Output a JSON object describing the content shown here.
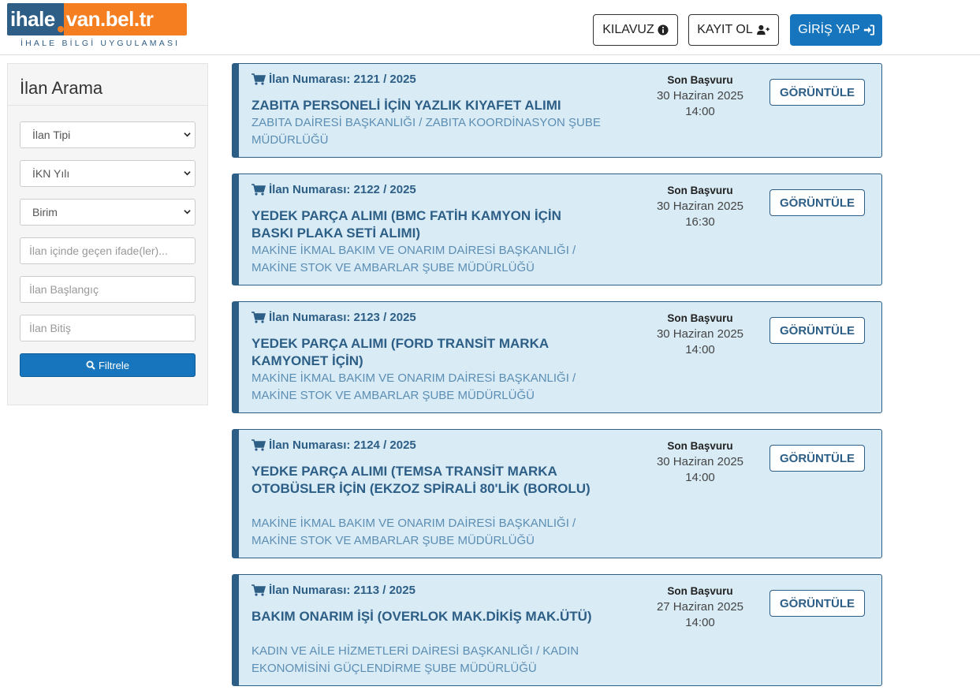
{
  "header": {
    "logo_left": "ihale",
    "logo_right": "van.bel.tr",
    "logo_sub": "İHALE BİLGİ UYGULAMASI",
    "guide_label": "KILAVUZ",
    "register_label": "KAYIT OL",
    "login_label": "GİRİŞ YAP",
    "icons": [
      "info-circle-icon",
      "user-plus-icon",
      "sign-in-icon"
    ]
  },
  "sidebar": {
    "title": "İlan Arama",
    "type_select": "İlan Tipi",
    "ikn_select": "İKN Yılı",
    "unit_select": "Birim",
    "text_placeholder": "İlan içinde geçen ifade(ler)...",
    "start_placeholder": "İlan Başlangıç",
    "end_placeholder": "İlan Bitiş",
    "filter_label": "Filtrele"
  },
  "listings": [
    {
      "number": "İlan Numarası: 2121 / 2025",
      "title": "ZABITA PERSONELİ İÇİN YAZLIK KIYAFET ALIMI",
      "unit": "ZABITA DAİRESİ BAŞKANLIĞI / ZABITA KOORDİNASYON ŞUBE MÜDÜRLÜĞÜ",
      "deadline_label": "Son Başvuru",
      "date": "30 Haziran 2025",
      "time": "14:00",
      "button": "GÖRÜNTÜLE"
    },
    {
      "number": "İlan Numarası: 2122 / 2025",
      "title": "YEDEK PARÇA ALIMI (BMC FATİH KAMYON İÇİN BASKI PLAKA SETİ ALIMI)",
      "unit": "MAKİNE İKMAL BAKIM VE ONARIM DAİRESİ BAŞKANLIĞI / MAKİNE STOK VE AMBARLAR ŞUBE MÜDÜRLÜĞÜ",
      "deadline_label": "Son Başvuru",
      "date": "30 Haziran 2025",
      "time": "16:30",
      "button": "GÖRÜNTÜLE"
    },
    {
      "number": "İlan Numarası: 2123 / 2025",
      "title": "YEDEK PARÇA ALIMI (FORD TRANSİT MARKA KAMYONET İÇİN)",
      "unit": "MAKİNE İKMAL BAKIM VE ONARIM DAİRESİ BAŞKANLIĞI / MAKİNE STOK VE AMBARLAR ŞUBE MÜDÜRLÜĞÜ",
      "deadline_label": "Son Başvuru",
      "date": "30 Haziran 2025",
      "time": "14:00",
      "button": "GÖRÜNTÜLE"
    },
    {
      "number": "İlan Numarası: 2124 / 2025",
      "title": "YEDKE PARÇA ALIMI (TEMSA TRANSİT MARKA OTOBÜSLER İÇİN (EKZOZ SPİRALİ 80'LİK (BOROLU)",
      "unit": "MAKİNE İKMAL BAKIM VE ONARIM DAİRESİ BAŞKANLIĞI / MAKİNE STOK VE AMBARLAR ŞUBE MÜDÜRLÜĞÜ",
      "deadline_label": "Son Başvuru",
      "date": "30 Haziran 2025",
      "time": "14:00",
      "button": "GÖRÜNTÜLE"
    },
    {
      "number": "İlan Numarası: 2113 / 2025",
      "title": "BAKIM ONARIM İŞİ (OVERLOK MAK.DİKİŞ MAK.ÜTÜ)",
      "unit": "KADIN VE AİLE HİZMETLERİ DAİRESİ BAŞKANLIĞI / KADIN EKONOMİSİNİ GÜÇLENDİRME ŞUBE MÜDÜRLÜĞÜ",
      "deadline_label": "Son Başvuru",
      "date": "27 Haziran 2025",
      "time": "14:00",
      "button": "GÖRÜNTÜLE"
    }
  ]
}
